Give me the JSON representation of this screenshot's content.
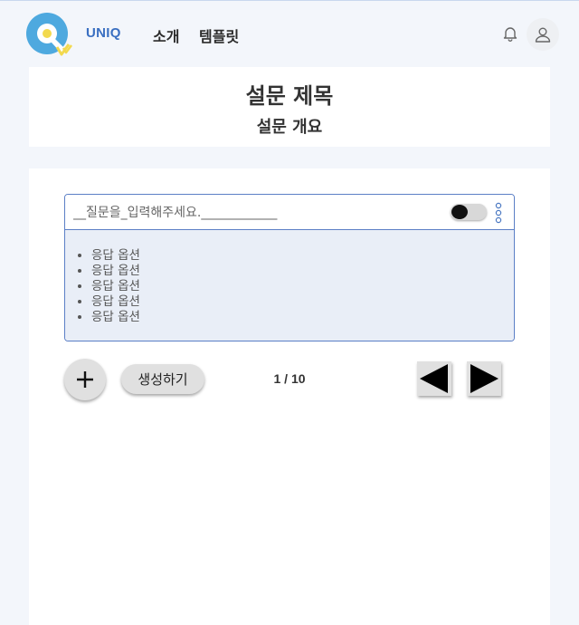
{
  "header": {
    "brand": "UNIQ",
    "nav": {
      "about": "소개",
      "template": "템플릿"
    },
    "icons": {
      "logo": "uniq-logo-icon",
      "notifications": "bell-icon",
      "profile": "user-icon"
    }
  },
  "survey": {
    "title": "설문 제목",
    "summary": "설문 개요"
  },
  "question": {
    "placeholder": "__질문을_입력해주세요.____________",
    "toggle_on": false,
    "options": [
      "응답 옵션",
      "응답 옵션",
      "응답 옵션",
      "응답 옵션",
      "응답 옵션"
    ]
  },
  "controls": {
    "add_icon": "plus-icon",
    "create_label": "생성하기",
    "page_indicator": "1 / 10",
    "prev_icon": "triangle-left-icon",
    "next_icon": "triangle-right-icon"
  },
  "colors": {
    "brand": "#3a6fc1",
    "background": "#f3f6fb",
    "question_border": "#5b7fc6",
    "options_bg": "#e9eef7",
    "logo_circle": "#4ea9df",
    "logo_accent": "#f2d94e"
  }
}
